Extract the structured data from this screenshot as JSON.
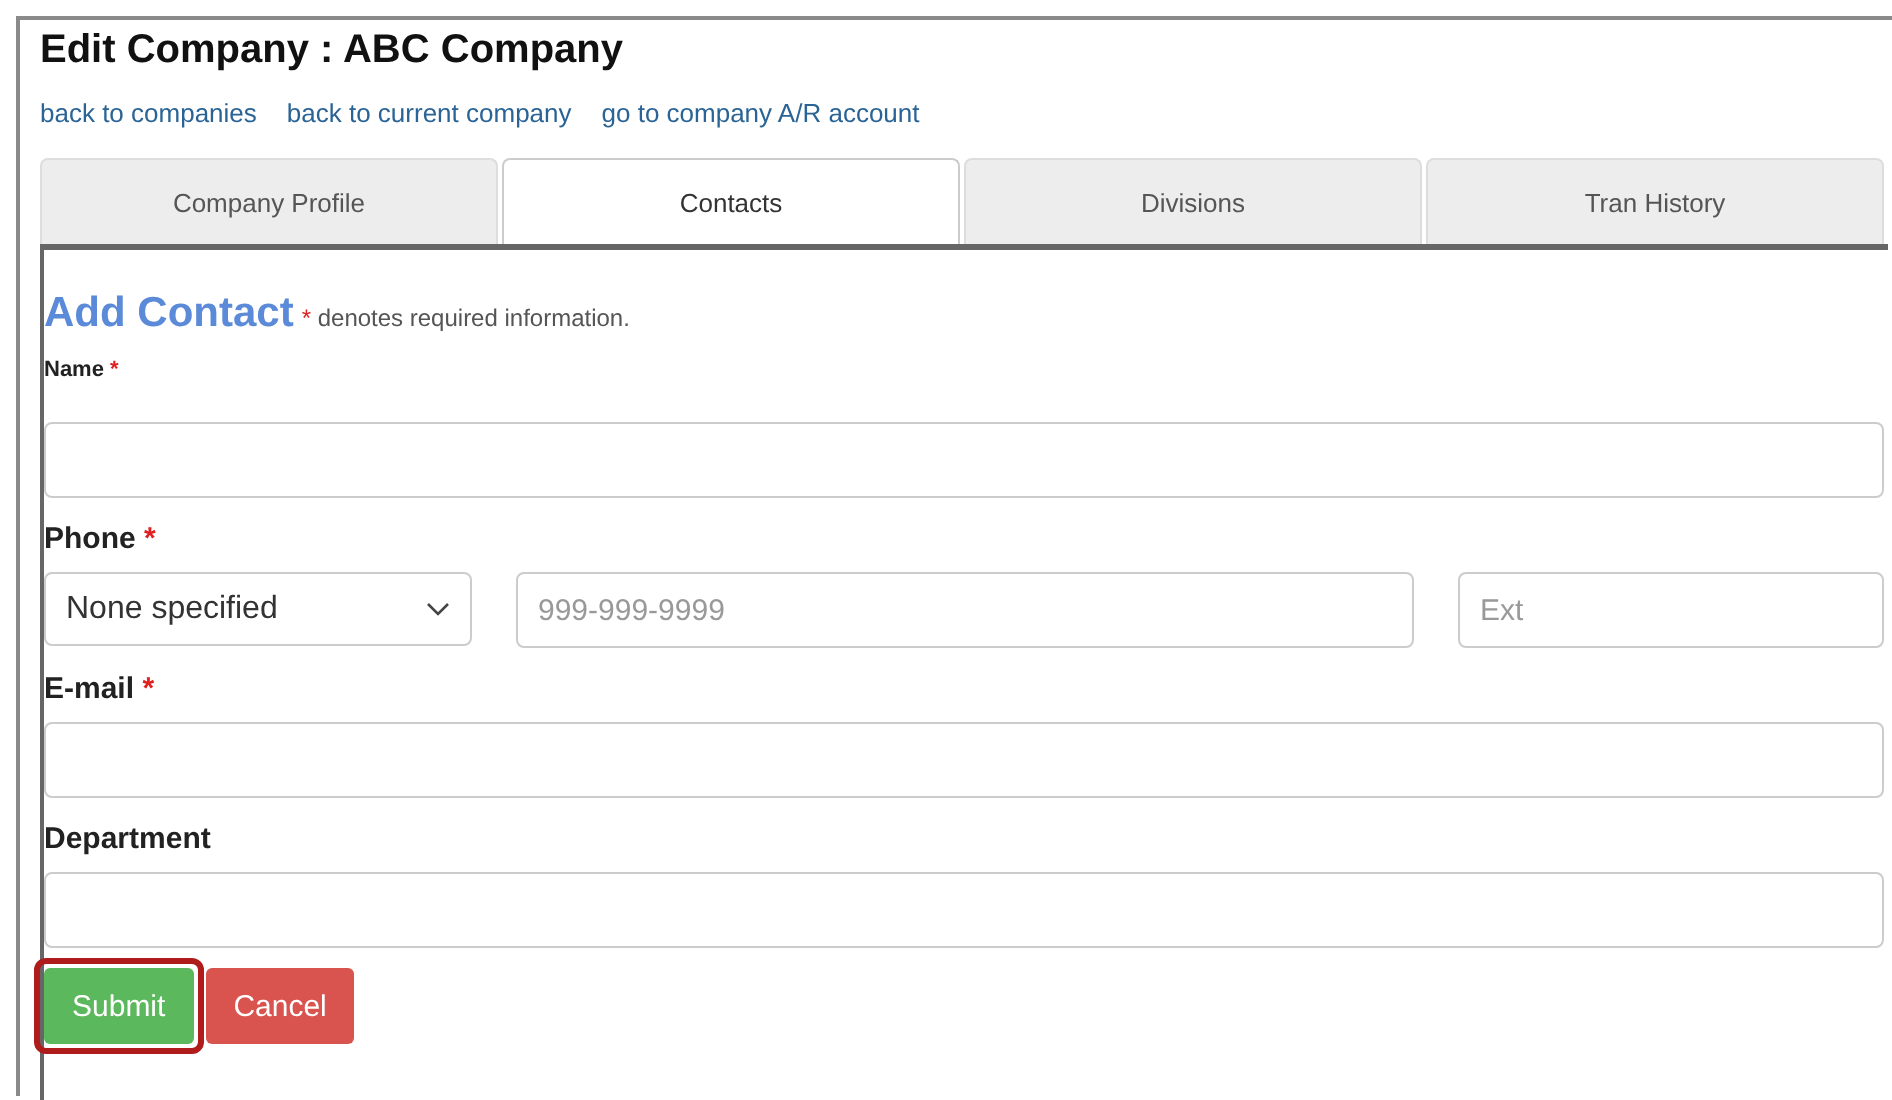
{
  "title": "Edit Company : ABC Company",
  "links": [
    "back to companies",
    "back to current company",
    "go to company A/R account"
  ],
  "tabs": [
    {
      "label": "Company Profile",
      "selected": false
    },
    {
      "label": "Contacts",
      "selected": true
    },
    {
      "label": "Divisions",
      "selected": false
    },
    {
      "label": "Tran History",
      "selected": false
    }
  ],
  "form": {
    "heading": "Add Contact",
    "note_mark": "*",
    "note": "denotes required information.",
    "fields": [
      {
        "kind": "text",
        "label": "Name",
        "required_mark": "*"
      },
      {
        "kind": "phone",
        "label": "Phone",
        "required_mark": "*",
        "type_value": "None specified",
        "number_placeholder": "999-999-9999",
        "ext_placeholder": "Ext"
      },
      {
        "kind": "text",
        "label": "E-mail",
        "required_mark": "*"
      },
      {
        "kind": "text",
        "label": "Department"
      }
    ]
  },
  "buttons": [
    {
      "label": "Submit",
      "kind": "submit",
      "highlighted": true
    },
    {
      "label": "Cancel",
      "kind": "cancel"
    }
  ]
}
